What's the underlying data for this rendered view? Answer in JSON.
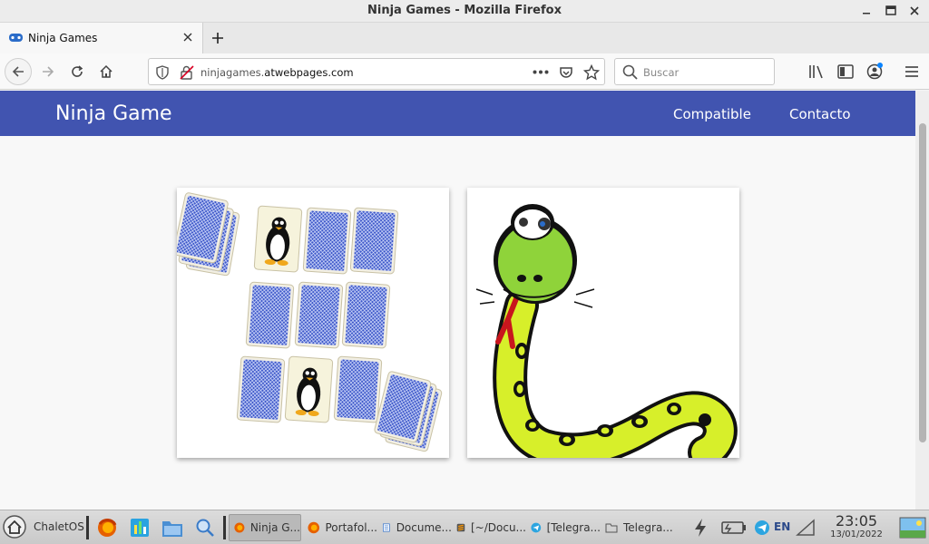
{
  "window": {
    "title": "Ninja Games - Mozilla Firefox"
  },
  "tab": {
    "label": "Ninja Games",
    "favicon": "gamepad-icon"
  },
  "navbar": {
    "url_host": "ninjagames.",
    "url_domain": "atwebpages.com",
    "search_placeholder": "Buscar"
  },
  "site": {
    "brand": "Ninja Game",
    "nav": [
      "Compatible",
      "Contacto"
    ],
    "header_color": "#4154b0",
    "cards": [
      {
        "name": "memory-game",
        "image": "memory-cards-penguins"
      },
      {
        "name": "snake-game",
        "image": "cartoon-snake"
      }
    ]
  },
  "taskbar": {
    "start_label": "ChaletOS",
    "tasks": [
      {
        "label": "Ninja G...",
        "icon": "firefox-icon",
        "active": true
      },
      {
        "label": "Portafol...",
        "icon": "firefox-icon",
        "active": false
      },
      {
        "label": "Docume...",
        "icon": "document-icon",
        "active": false
      },
      {
        "label": "[~/Docu...",
        "icon": "sublime-icon",
        "active": false
      },
      {
        "label": "[Telegra...",
        "icon": "telegram-icon",
        "active": false
      },
      {
        "label": "Telegra...",
        "icon": "folder-icon",
        "active": false
      }
    ],
    "lang": "EN",
    "time": "23:05",
    "date": "13/01/2022"
  }
}
